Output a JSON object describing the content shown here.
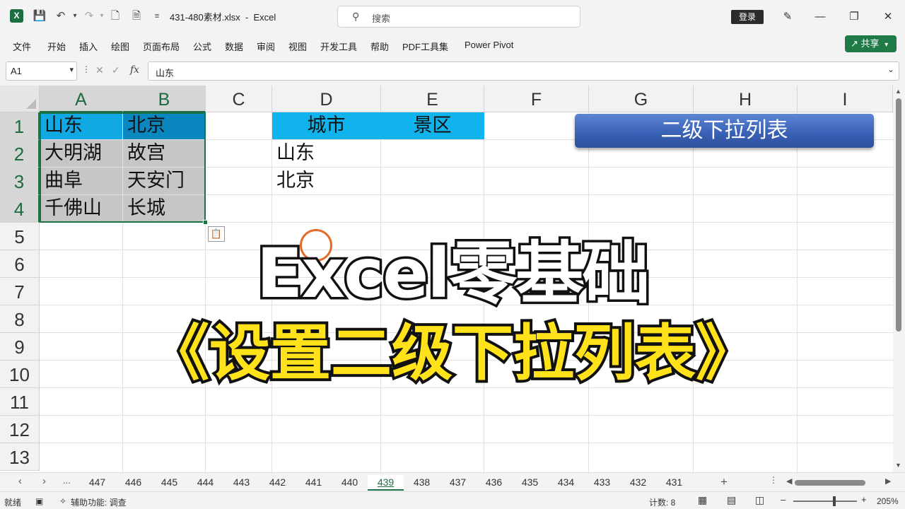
{
  "titlebar": {
    "app_logo": "X",
    "filename": "431-480素材.xlsx",
    "app_name": "Excel",
    "search_placeholder": "搜索",
    "login_label": "登录",
    "icons": [
      "save-icon",
      "undo-icon",
      "redo-icon",
      "new-file-icon",
      "print-preview-icon",
      "customize-icon",
      "pen-icon",
      "minimize-icon",
      "restore-icon",
      "close-icon"
    ]
  },
  "ribbon": {
    "tabs": [
      "文件",
      "开始",
      "插入",
      "绘图",
      "页面布局",
      "公式",
      "数据",
      "审阅",
      "视图",
      "开发工具",
      "帮助",
      "PDF工具集",
      "Power Pivot"
    ],
    "share_label": "共享"
  },
  "formula_bar": {
    "name_box": "A1",
    "fx_label": "fx",
    "formula": "山东"
  },
  "grid": {
    "columns": [
      "A",
      "B",
      "C",
      "D",
      "E",
      "F",
      "G",
      "H",
      "I"
    ],
    "rows": [
      "1",
      "2",
      "3",
      "4",
      "5",
      "6",
      "7",
      "8",
      "9",
      "10",
      "11",
      "12",
      "13"
    ],
    "cells": {
      "A1": "山东",
      "B1": "北京",
      "A2": "大明湖",
      "B2": "故宫",
      "A3": "曲阜",
      "B3": "天安门",
      "A4": "千佛山",
      "B4": "长城",
      "D1": "城市",
      "E1": "景区",
      "D2": "山东",
      "D3": "北京"
    },
    "title_shape": "二级下拉列表",
    "colors": {
      "a1_fill": "#10a9e4",
      "b1_fill": "#0a87bf",
      "range_fill": "#c6c6c6",
      "header_fill": "#11b3ec",
      "selection": "#1e7145"
    }
  },
  "overlay": {
    "line1": "Excel零基础",
    "line2": "《设置二级下拉列表》"
  },
  "sheets": {
    "more": "...",
    "tabs": [
      "447",
      "446",
      "445",
      "444",
      "443",
      "442",
      "441",
      "440",
      "439",
      "438",
      "437",
      "436",
      "435",
      "434",
      "433",
      "432",
      "431"
    ],
    "active": "439",
    "add": "+"
  },
  "status": {
    "ready": "就绪",
    "accessibility": "辅助功能: 调查",
    "count": "计数: 8",
    "zoom": "205%"
  }
}
